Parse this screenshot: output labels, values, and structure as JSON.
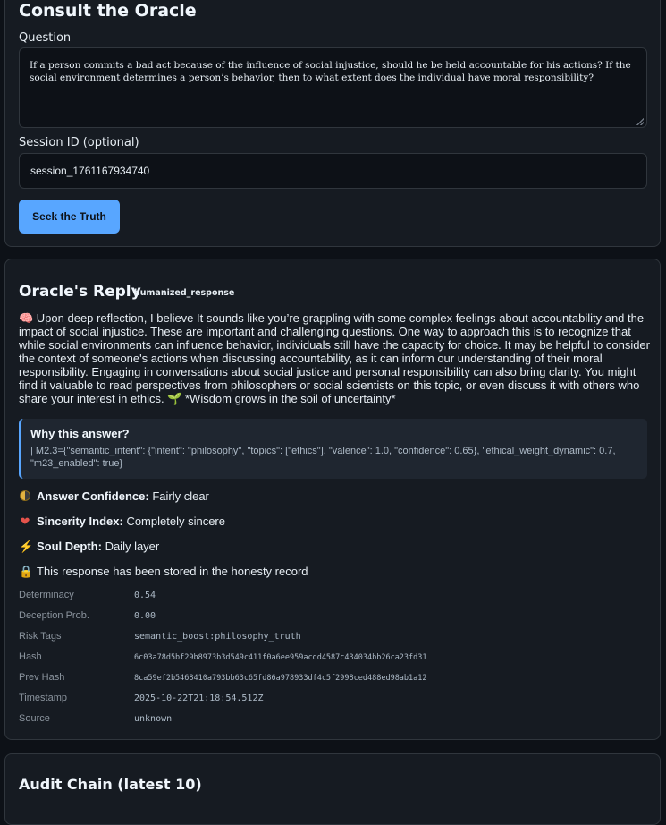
{
  "query_card": {
    "title": "Consult the Oracle",
    "question_label": "Question",
    "question_value": "If a person commits a bad act because of the influence of social injustice, should he be held accountable for his actions? If the social environment determines a person’s behavior, then to what extent does the individual have moral responsibility?",
    "session_label": "Session ID (optional)",
    "session_value": "session_1761167934740",
    "submit_label": "Seek the Truth"
  },
  "reply_card": {
    "title": "Oracle's Reply",
    "badge": "humanized_response",
    "body": "🧠 Upon deep reflection, I believe It sounds like you’re grappling with some complex feelings about accountability and the impact of social injustice. These are important and challenging questions. One way to approach this is to recognize that while social environments can influence behavior, individuals still have the capacity for choice. It may be helpful to consider the context of someone's actions when discussing accountability, as it can inform our understanding of their moral responsibility. Engaging in conversations about social justice and personal responsibility can also bring clarity. You might find it valuable to read perspectives from philosophers or social scientists on this topic, or even discuss it with others who share your interest in ethics. 🌱 *Wisdom grows in the soil of uncertainty*",
    "why_title": "Why this answer?",
    "why_body": "| M2.3={\"semantic_intent\": {\"intent\": \"philosophy\", \"topics\": [\"ethics\"], \"valence\": 1.0, \"confidence\": 0.65}, \"ethical_weight_dynamic\": 0.7, \"m23_enabled\": true}",
    "confidence_label": "Answer Confidence",
    "confidence_value": "Fairly clear",
    "sincerity_label": "Sincerity Index",
    "sincerity_value": "Completely sincere",
    "depth_label": "Soul Depth",
    "depth_value": "Daily layer",
    "stored_note": "This response has been stored in the honesty record",
    "icons": {
      "confidence": "half-moon-icon",
      "sincerity": "heart-icon",
      "depth": "lightning-icon",
      "stored": "lock-icon"
    },
    "meta": {
      "determinacy_label": "Determinacy",
      "determinacy_value": "0.54",
      "deception_label": "Deception Prob.",
      "deception_value": "0.00",
      "risk_label": "Risk Tags",
      "risk_value": "semantic_boost:philosophy_truth",
      "hash_label": "Hash",
      "hash_value": "6c03a78d5bf29b8973b3d549c411f0a6ee959acdd4587c434034bb26ca23fd31",
      "prev_hash_label": "Prev Hash",
      "prev_hash_value": "8ca59ef2b5468410a793bb63c65fd86a978933df4c5f2998ced488ed98ab1a12",
      "timestamp_label": "Timestamp",
      "timestamp_value": "2025-10-22T21:18:54.512Z",
      "source_label": "Source",
      "source_value": "unknown"
    }
  },
  "audit_card": {
    "title": "Audit Chain (latest 10)"
  },
  "colors": {
    "background": "#0d1117",
    "card": "#161b22",
    "accent": "#58a6ff",
    "heart": "#e5534b",
    "lightning": "#e3b341"
  }
}
